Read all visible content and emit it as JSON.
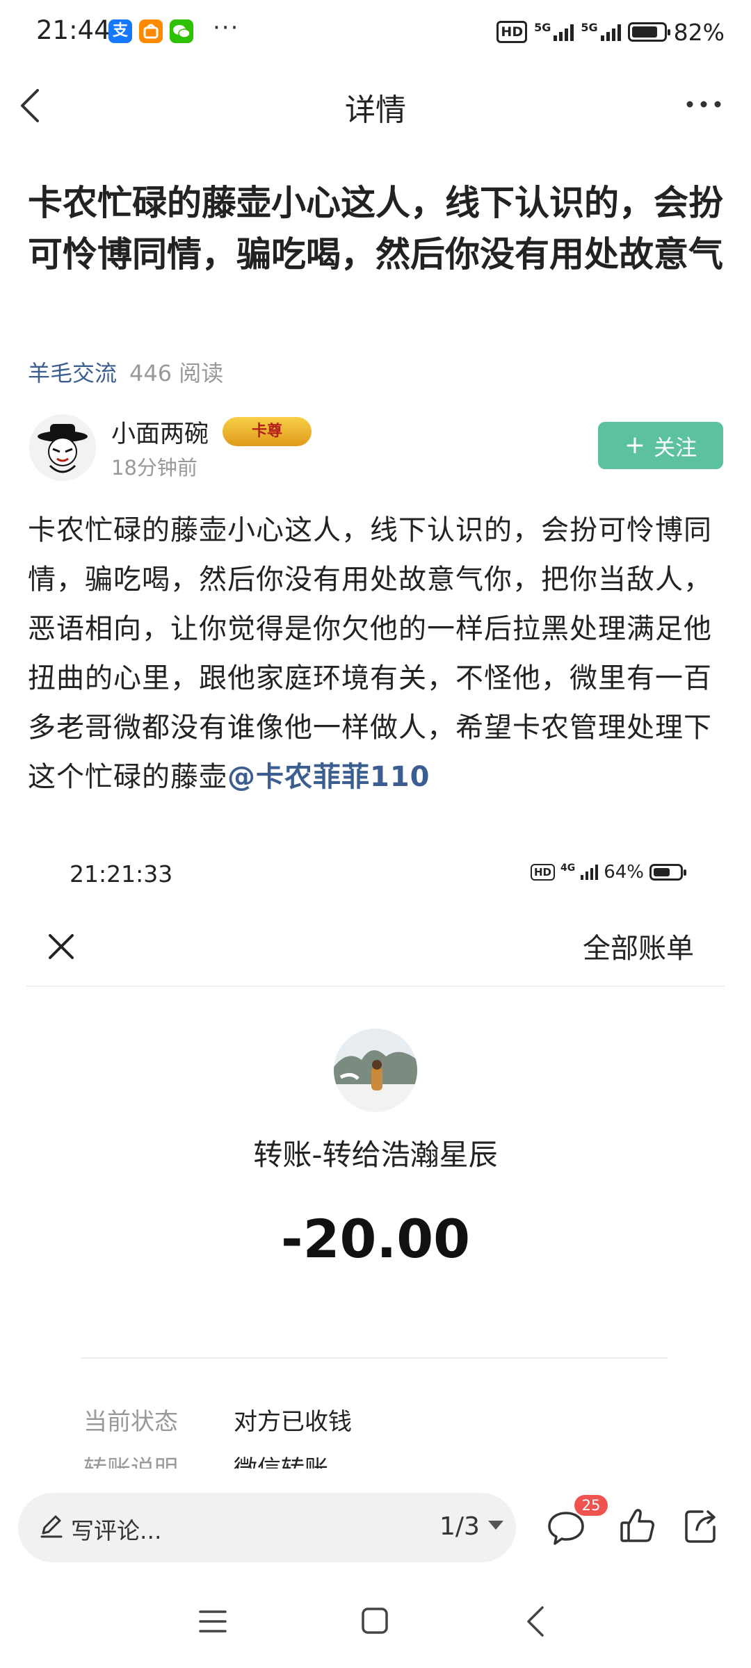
{
  "status_bar": {
    "time": "21:44",
    "app_icons": [
      "alipay-icon",
      "taobao-icon",
      "wechat-icon"
    ],
    "more": "···",
    "hd": "HD",
    "network_1": "5G",
    "network_2": "5G",
    "battery_percent": "82%",
    "battery_level": 0.82
  },
  "nav": {
    "title": "详情",
    "back_icon": "chevron-left-icon",
    "more_icon": "more-dots-icon"
  },
  "post": {
    "title": "卡农忙碌的藤壶小心这人，线下认识的，会扮可怜博同情，骗吃喝，然后你没有用处故意气",
    "category": "羊毛交流",
    "read_count": "446",
    "read_label": "阅读",
    "author": {
      "name": "小面两碗",
      "badge": "卡尊",
      "time": "18分钟前"
    },
    "follow_label": "关注",
    "body": "卡农忙碌的藤壶小心这人，线下认识的，会扮可怜博同情，骗吃喝，然后你没有用处故意气你，把你当敌人，恶语相向，让你觉得是你欠他的一样后拉黑处理满足他扭曲的心里，跟他家庭环境有关，不怪他，微里有一百多老哥微都没有谁像他一样做人，希望卡农管理处理下这个忙碌的藤壶",
    "mention": "@卡农菲菲110"
  },
  "embedded_screenshot": {
    "time": "21:21:33",
    "hd": "HD",
    "network": "4G",
    "battery_percent": "64%",
    "battery_level": 0.64,
    "all_bills_label": "全部账单",
    "transfer_title": "转账-转给浩瀚星辰",
    "amount": "-20.00",
    "rows": [
      {
        "label": "当前状态",
        "value": "对方已收钱"
      },
      {
        "label": "转账说明",
        "value": "微信转账"
      }
    ]
  },
  "bottom_bar": {
    "comment_placeholder": "写评论...",
    "page_indicator": "1/3",
    "comment_count": "25"
  },
  "colors": {
    "accent_green": "#5cc19e",
    "link_blue": "#3b5d8f",
    "badge_red": "#ef5350"
  }
}
